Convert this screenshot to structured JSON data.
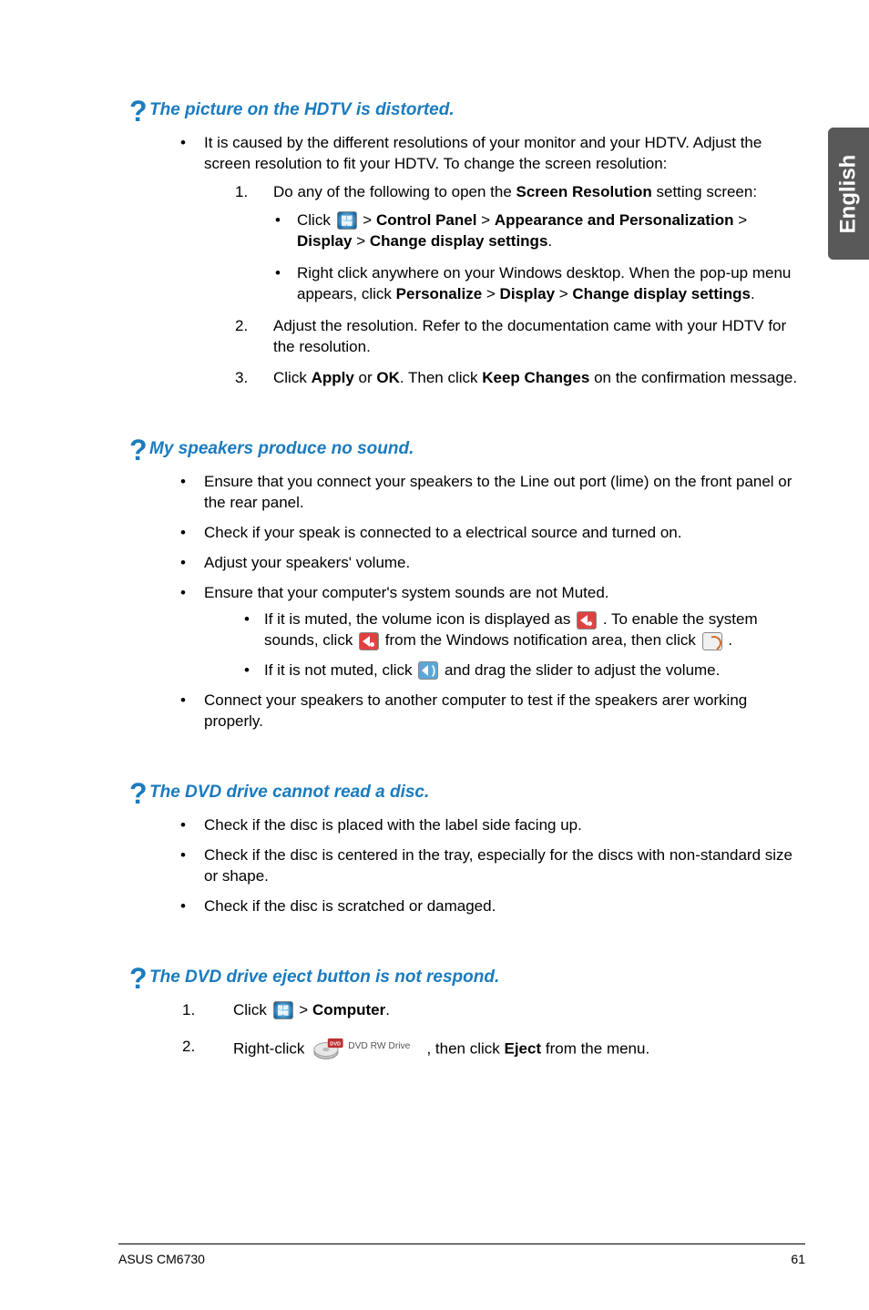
{
  "side_tab": "English",
  "sections": [
    {
      "heading": "The picture on the HDTV is distorted.",
      "intro": [
        "It is caused by the different resolutions of your monitor and your HDTV. Adjust the screen resolution to fit your HDTV. To change the screen resolution:"
      ],
      "steps": [
        {
          "num": "1.",
          "text_a": "Do any of the following to open the ",
          "text_b": "Screen Resolution",
          "text_c": " setting screen:",
          "subs": [
            {
              "pre": "Click ",
              "seq": [
                " > ",
                "Control Panel",
                " > ",
                "Appearance and Personalization",
                " > ",
                "Display",
                " > ",
                "Change display settings",
                "."
              ]
            },
            {
              "plain_a": "Right click anywhere on your Windows desktop. When the pop-up menu appears, click ",
              "b1": "Personalize",
              "sep1": " > ",
              "b2": "Display",
              "sep2": " > ",
              "b3": "Change display settings",
              "tail": "."
            }
          ]
        },
        {
          "num": "2.",
          "plain": "Adjust the resolution. Refer to the documentation came with your HDTV for the resolution."
        },
        {
          "num": "3.",
          "pre": "Click ",
          "b1": "Apply",
          "mid": " or ",
          "b2": "OK",
          "post_a": ". Then click ",
          "b3": "Keep Changes",
          "post_b": " on the confirmation message."
        }
      ]
    },
    {
      "heading": "My speakers produce no sound.",
      "bullets": [
        {
          "plain": "Ensure that you connect your speakers to the Line out port (lime) on the front panel or the rear panel."
        },
        {
          "plain": "Check if your speak is connected to a electrical source and turned on."
        },
        {
          "plain": "Adjust your speakers' volume."
        },
        {
          "plain": "Ensure that your computer's system sounds are not Muted.",
          "subs": [
            {
              "t1": "If it is muted, the volume icon is displayed as ",
              "t2": " . To enable the system sounds, click ",
              "t3": " from the Windows notification area, then click ",
              "t4": " ."
            },
            {
              "u1": "If it is not muted, click ",
              "u2": " and drag the slider to adjust the volume."
            }
          ]
        },
        {
          "plain": "Connect your speakers to another computer to test if the speakers arer working properly."
        }
      ]
    },
    {
      "heading": "The DVD drive cannot read a disc.",
      "bullets": [
        {
          "plain": "Check if the disc is placed with the label side facing up."
        },
        {
          "plain": "Check if the disc is centered in the tray, especially for the discs with non-standard size or shape."
        },
        {
          "plain": "Check if the disc is scratched or damaged."
        }
      ]
    },
    {
      "heading": "The DVD drive eject button is not respond.",
      "steps2": [
        {
          "num": "1.",
          "pre": "Click ",
          "post_a": " > ",
          "b1": "Computer",
          "tail": "."
        },
        {
          "num": "2.",
          "pre": "Right-click ",
          "mid": ", then click ",
          "b1": "Eject",
          "tail": " from the menu."
        }
      ]
    }
  ],
  "footer": {
    "left": "ASUS CM6730",
    "right": "61"
  },
  "icons": {
    "dvd_label": "DVD RW Drive"
  }
}
